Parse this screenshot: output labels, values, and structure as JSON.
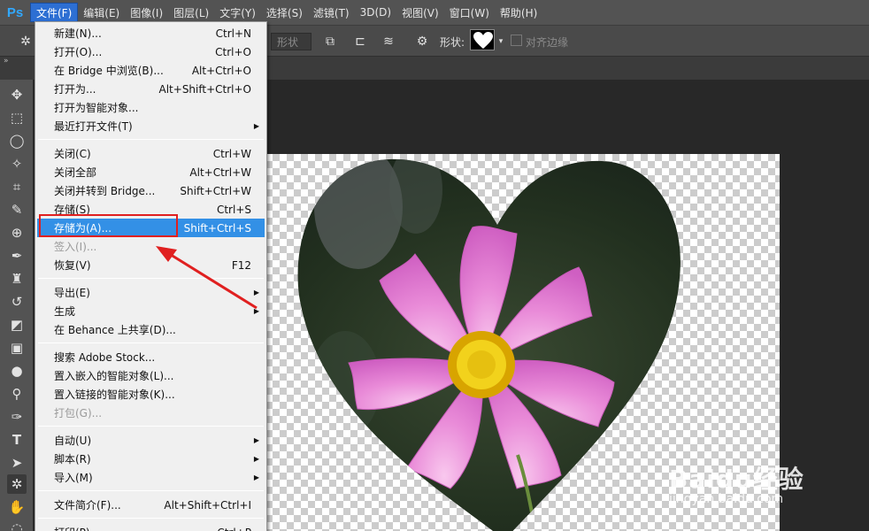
{
  "app": {
    "logo": "Ps"
  },
  "menubar": [
    {
      "label": "文件(F)",
      "active": true
    },
    {
      "label": "编辑(E)"
    },
    {
      "label": "图像(I)"
    },
    {
      "label": "图层(L)"
    },
    {
      "label": "文字(Y)"
    },
    {
      "label": "选择(S)"
    },
    {
      "label": "滤镜(T)"
    },
    {
      "label": "3D(D)"
    },
    {
      "label": "视图(V)"
    },
    {
      "label": "窗口(W)"
    },
    {
      "label": "帮助(H)"
    }
  ],
  "options": {
    "shape_field": "形状",
    "shape_label": "形状:",
    "align_edges": "对齐边缘"
  },
  "file_menu": {
    "groups": [
      [
        {
          "label": "新建(N)...",
          "shortcut": "Ctrl+N"
        },
        {
          "label": "打开(O)...",
          "shortcut": "Ctrl+O"
        },
        {
          "label": "在 Bridge 中浏览(B)...",
          "shortcut": "Alt+Ctrl+O"
        },
        {
          "label": "打开为...",
          "shortcut": "Alt+Shift+Ctrl+O"
        },
        {
          "label": "打开为智能对象..."
        },
        {
          "label": "最近打开文件(T)",
          "submenu": true
        }
      ],
      [
        {
          "label": "关闭(C)",
          "shortcut": "Ctrl+W"
        },
        {
          "label": "关闭全部",
          "shortcut": "Alt+Ctrl+W"
        },
        {
          "label": "关闭并转到 Bridge...",
          "shortcut": "Shift+Ctrl+W"
        },
        {
          "label": "存储(S)",
          "shortcut": "Ctrl+S"
        },
        {
          "label": "存储为(A)...",
          "shortcut": "Shift+Ctrl+S",
          "highlighted": true
        },
        {
          "label": "签入(I)...",
          "disabled": true
        },
        {
          "label": "恢复(V)",
          "shortcut": "F12"
        }
      ],
      [
        {
          "label": "导出(E)",
          "submenu": true
        },
        {
          "label": "生成",
          "submenu": true
        },
        {
          "label": "在 Behance 上共享(D)..."
        }
      ],
      [
        {
          "label": "搜索 Adobe Stock..."
        },
        {
          "label": "置入嵌入的智能对象(L)..."
        },
        {
          "label": "置入链接的智能对象(K)..."
        },
        {
          "label": "打包(G)...",
          "disabled": true
        }
      ],
      [
        {
          "label": "自动(U)",
          "submenu": true
        },
        {
          "label": "脚本(R)",
          "submenu": true
        },
        {
          "label": "导入(M)",
          "submenu": true
        }
      ],
      [
        {
          "label": "文件简介(F)...",
          "shortcut": "Alt+Shift+Ctrl+I"
        }
      ],
      [
        {
          "label": "打印(P)...",
          "shortcut": "Ctrl+P"
        }
      ]
    ]
  },
  "watermark": {
    "brand": "Baidu经验",
    "url": "jingyan.baidu.com"
  },
  "colors": {
    "highlight": "#3390e6",
    "annotation": "#e02020",
    "menubar": "#535353"
  }
}
